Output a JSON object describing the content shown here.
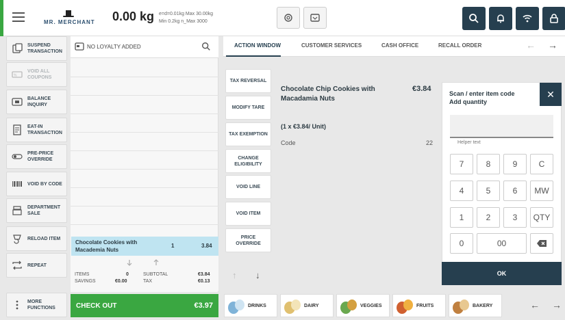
{
  "header": {
    "logo_text": "MR. MERCHANT",
    "weight": "0.00 kg",
    "scale_info_line1": "e=d=0.01kg Max 30.00kg",
    "scale_info_line2": "Min 0.2kg n_Max 3000"
  },
  "left_menu": [
    {
      "label": "SUSPEND TRANSACTION",
      "icon": "suspend-icon",
      "enabled": true
    },
    {
      "label": "VOID ALL COUPONS",
      "icon": "coupon-icon",
      "enabled": false
    },
    {
      "label": "BALANCE INQUIRY",
      "icon": "card-icon",
      "enabled": true
    },
    {
      "label": "EAT-IN TRANSACTION",
      "icon": "receipt-icon",
      "enabled": true
    },
    {
      "label": "PRE-PRICE OVERRIDE",
      "icon": "toggle-icon",
      "enabled": true
    },
    {
      "label": "VOID BY CODE",
      "icon": "barcode-icon",
      "enabled": true
    },
    {
      "label": "DEPARTMENT SALE",
      "icon": "register-icon",
      "enabled": true
    },
    {
      "label": "RELOAD ITEM",
      "icon": "reload-icon",
      "enabled": true
    },
    {
      "label": "REPEAT",
      "icon": "repeat-icon",
      "enabled": true
    },
    {
      "label": "MORE FUNCTIONS",
      "icon": "more-icon",
      "enabled": true
    }
  ],
  "basket": {
    "loyalty_text": "NO LOYALTY ADDED",
    "selected_item": {
      "name": "Chocolate Cookies with Macademia Nuts",
      "qty": "1",
      "price": "3.84"
    },
    "items_label": "ITEMS",
    "items_value": "0",
    "savings_label": "SAVINGS",
    "savings_value": "€0.00",
    "subtotal_label": "SUBTOTAL",
    "subtotal_value": "€3.84",
    "tax_label": "TAX",
    "tax_value": "€0.13",
    "checkout_label": "CHECK OUT",
    "checkout_total": "€3.97"
  },
  "tabs": [
    "ACTION WINDOW",
    "CUSTOMER SERVICES",
    "CASH OFFICE",
    "RECALL ORDER"
  ],
  "actions": [
    "TAX REVERSAL",
    "MODIFY TARE",
    "TAX EXEMPTION",
    "CHANGE ELIGIBILITY",
    "VOID LINE",
    "VOID ITEM",
    "PRICE OVERRIDE"
  ],
  "detail": {
    "name": "Chocolate Chip Cookies with Macadamia Nuts",
    "price": "€3.84",
    "qty_line": "(1 x €3.84/ Unit)",
    "code_label": "Code",
    "code_value": "22"
  },
  "keypad": {
    "title1": "Scan / enter item code",
    "title2": "Add quantity",
    "helper": "Helper text",
    "rows": [
      [
        "7",
        "8",
        "9",
        "C"
      ],
      [
        "4",
        "5",
        "6",
        "MW"
      ],
      [
        "1",
        "2",
        "3",
        "QTY"
      ]
    ],
    "zero": "0",
    "double_zero": "00",
    "ok": "OK"
  },
  "categories": [
    "DRINKS",
    "DAIRY",
    "VEGGIES",
    "FRUITS",
    "BAKERY"
  ],
  "colors": {
    "accent_green": "#3aa741",
    "nav_dark": "#263f4f",
    "selected_blue": "#bfe4f1"
  }
}
